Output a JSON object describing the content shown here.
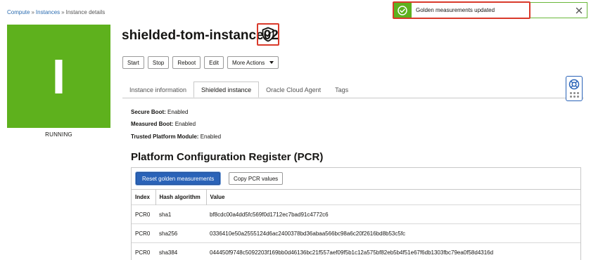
{
  "breadcrumb": {
    "items": [
      "Compute",
      "Instances",
      "Instance details"
    ],
    "separator": "»"
  },
  "instance": {
    "letter": "I",
    "status": "RUNNING",
    "name": "shielded-tom-instance02",
    "icon": "shield-check-icon",
    "status_color": "#5eb11d"
  },
  "actions": {
    "start": "Start",
    "stop": "Stop",
    "reboot": "Reboot",
    "edit": "Edit",
    "more": "More Actions"
  },
  "tabs": [
    {
      "label": "Instance information",
      "active": false
    },
    {
      "label": "Shielded instance",
      "active": true
    },
    {
      "label": "Oracle Cloud Agent",
      "active": false
    },
    {
      "label": "Tags",
      "active": false
    }
  ],
  "properties": [
    {
      "label": "Secure Boot:",
      "value": "Enabled"
    },
    {
      "label": "Measured Boot:",
      "value": "Enabled"
    },
    {
      "label": "Trusted Platform Module:",
      "value": "Enabled"
    }
  ],
  "pcr": {
    "title": "Platform Configuration Register (PCR)",
    "reset_label": "Reset golden measurements",
    "copy_label": "Copy PCR values",
    "columns": [
      "Index",
      "Hash algorithm",
      "Value"
    ],
    "rows": [
      [
        "PCR0",
        "sha1",
        "bf8cdc00a4dd5fc569f0d1712ec7bad91c4772c6"
      ],
      [
        "PCR0",
        "sha256",
        "0336410e50a2555124d6ac2400378bd36abaa566bc98a6c20f2616bd8b53c5fc"
      ],
      [
        "PCR0",
        "sha384",
        "044450f9748c5092203f169bb0d46136bc21f557aef09f5b1c12a575bf82eb5b4f51e67f6db1303fbc79ea0f58d4316d"
      ]
    ]
  },
  "toast": {
    "message": "Golden measurements updated",
    "icon": "check-circle-icon",
    "close_icon": "close-icon"
  },
  "help": {
    "icon": "lifebuoy-icon",
    "grid_icon": "app-grid-icon"
  },
  "colors": {
    "accent": "#2a63b8",
    "success": "#5eb11d",
    "highlight": "#d93a2b"
  }
}
